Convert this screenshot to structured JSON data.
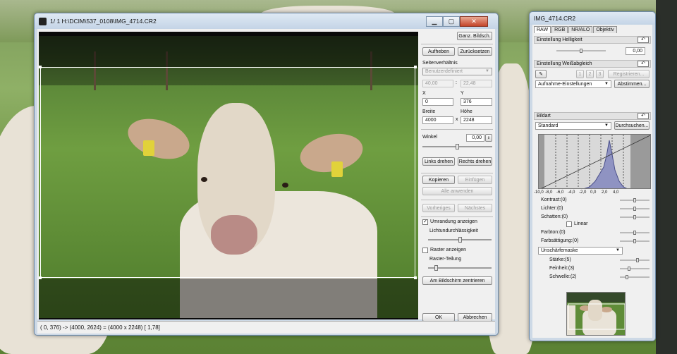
{
  "main_window": {
    "title": "1/  1  H:\\DCIM\\537_0108\\IMG_4714.CR2",
    "status": "(  0,  376) -> (4000, 2624) = (4000 x 2248) [ 1,78]",
    "controls": {
      "fit_screen": "Ganz. Bildsch.",
      "release": "Aufheben",
      "reset": "Zurücksetzen",
      "aspect_label": "Seitenverhältnis",
      "aspect_value": "Benutzerdefiniert",
      "ratio_w": "40,00",
      "ratio_sep": ":",
      "ratio_h": "22,48",
      "x_label": "X",
      "y_label": "Y",
      "x_value": "0",
      "y_value": "376",
      "width_label": "Breite",
      "height_label": "Höhe",
      "width_value": "4000",
      "times": "x",
      "height_value": "2248",
      "angle_label": "Winkel",
      "angle_value": "0,00",
      "rotate_left": "Links drehen",
      "rotate_right": "Rechts drehen",
      "copy": "Kopieren",
      "paste": "Einfügen",
      "apply_all": "Alle anwenden",
      "previous": "Vorheriges",
      "next": "Nächstes",
      "show_border": "Umrandung anzeigen",
      "show_border_checked": true,
      "light_transmission": "Lichtundurchlässigkeit",
      "show_grid": "Raster anzeigen",
      "show_grid_checked": false,
      "grid_division": "Raster-Teilung",
      "center_on_screen": "Am Bildschirm zentrieren",
      "ok": "OK",
      "cancel": "Abbrechen"
    },
    "light_transmission_level": 0.5,
    "angle_level": 0.5,
    "grid_division_level": 0.1
  },
  "tool_window": {
    "title": "IMG_4714.CR2",
    "tabs": [
      "RAW",
      "RGB",
      "NR/ALO",
      "Objektiv"
    ],
    "active_tab": "RAW",
    "brightness": {
      "header": "Einstellung Helligkeit",
      "value": "0,00",
      "level": 0.5
    },
    "white_balance": {
      "header": "Einstellung Weißabgleich",
      "buttons": [
        "1",
        "2",
        "3"
      ],
      "register": "Registrieren...",
      "preset": "Aufnahme-Einstellungen",
      "fine_tune": "Abstimmen..."
    },
    "picture_style": {
      "header": "Bildart",
      "value": "Standard",
      "browse": "Durchsuchen..."
    },
    "histogram_ticks": [
      "-10,0",
      "-8,0",
      "-6,0",
      "-4,0",
      "-2,0",
      "0,0",
      "2,0",
      "4,0"
    ],
    "params": [
      {
        "label": "Kontrast:(0)",
        "level": 0.5
      },
      {
        "label": "Lichter:(0)",
        "level": 0.5
      },
      {
        "label": "Schatten:(0)",
        "level": 0.5
      },
      {
        "label": "Farbton:(0)",
        "level": 0.5
      },
      {
        "label": "Farbsättigung:(0)",
        "level": 0.5
      }
    ],
    "linear": "Linear",
    "sharpen_mode": "Unschärfemaske",
    "sharpen": [
      {
        "label": "Stärke:(5)",
        "level": 0.6
      },
      {
        "label": "Feinheit:(3)",
        "level": 0.3
      },
      {
        "label": "Schwelle:(2)",
        "level": 0.2
      }
    ]
  },
  "icons": {
    "undo": "undo-icon",
    "eyedropper": "eyedropper-icon",
    "app": "camera-app-icon",
    "minimize": "minimize-icon",
    "maximize": "maximize-icon",
    "close": "close-icon"
  },
  "colors": {
    "titlebar": "#cdd9e6",
    "close": "#c4442a",
    "histogram_fill": "#8f93c2"
  }
}
